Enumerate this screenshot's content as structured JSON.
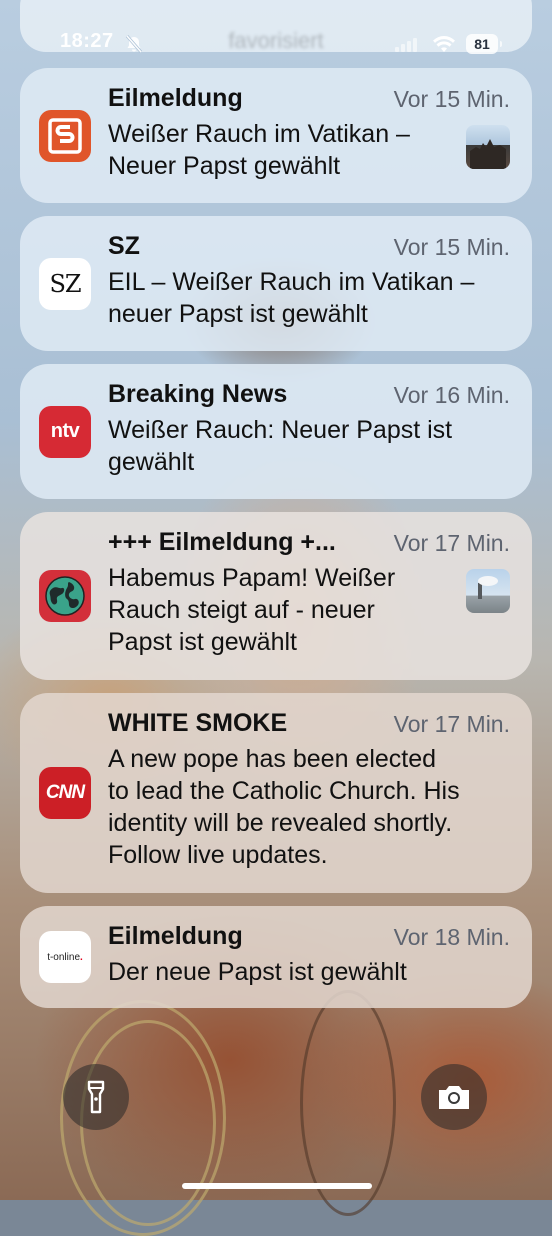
{
  "top_partial": {
    "text": "favorisiert"
  },
  "status_bar": {
    "time": "18:27",
    "battery": "81",
    "icons": [
      "bell-slash-icon",
      "cellular-signal-icon",
      "wifi-icon",
      "battery-icon"
    ]
  },
  "notifications": [
    {
      "app": "S",
      "title": "Eilmeldung",
      "time": "Vor 15 Min.",
      "line1": "Weißer Rauch im Vatikan –",
      "line2": "Neuer Papst gewählt",
      "line3": "",
      "line4": "",
      "icon": "s-app-icon",
      "has_thumb": true
    },
    {
      "app": "SZ",
      "title": "SZ",
      "time": "Vor 15 Min.",
      "line1": "EIL – Weißer Rauch im Vatikan –",
      "line2": "neuer Papst ist gewählt",
      "line3": "",
      "line4": "",
      "icon": "sz-app-icon"
    },
    {
      "app": "ntv",
      "title": "Breaking News",
      "time": "Vor 16 Min.",
      "line1": "Weißer Rauch: Neuer Papst ist",
      "line2": "gewählt",
      "line3": "",
      "line4": "",
      "icon": "ntv-app-icon"
    },
    {
      "app": "globe",
      "title": "+++ Eilmeldung +...",
      "time": "Vor 17 Min.",
      "line1": "Habemus Papam! Weißer",
      "line2": "Rauch steigt auf - neuer",
      "line3": "Papst ist gewählt",
      "line4": "",
      "icon": "globe-app-icon",
      "has_thumb": true
    },
    {
      "app": "CNN",
      "title": "WHITE SMOKE",
      "time": "Vor 17 Min.",
      "line1": "A new pope has been elected",
      "line2": "to lead the Catholic Church. His",
      "line3": "identity will be revealed shortly.",
      "line4": "Follow live updates.",
      "icon": "cnn-app-icon"
    },
    {
      "app": "t-online.",
      "title": "Eilmeldung",
      "time": "Vor 18 Min.",
      "line1": "Der neue Papst ist gewählt",
      "line2": "",
      "line3": "",
      "line4": "",
      "icon": "t-online-app-icon"
    }
  ],
  "controls": {
    "flashlight": "flashlight-icon",
    "camera": "camera-icon"
  }
}
